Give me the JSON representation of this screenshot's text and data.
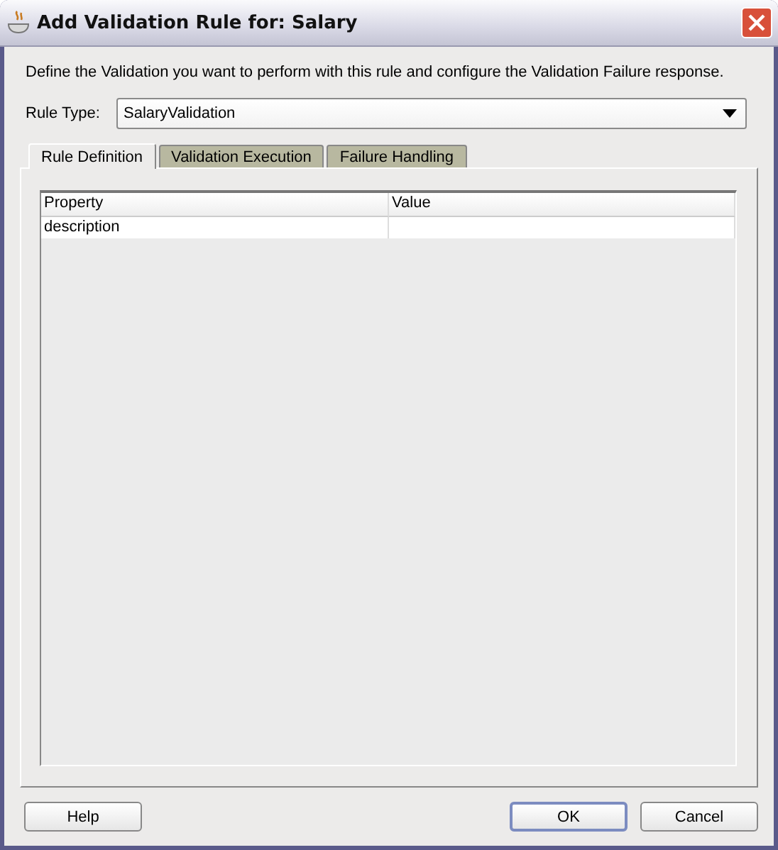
{
  "window": {
    "title": "Add Validation Rule for: Salary"
  },
  "intro": "Define the Validation you want to perform with this rule and configure the Validation Failure response.",
  "rule_type": {
    "label": "Rule Type:",
    "value": "SalaryValidation"
  },
  "tabs": [
    {
      "label": "Rule Definition",
      "selected": true
    },
    {
      "label": "Validation Execution",
      "selected": false
    },
    {
      "label": "Failure Handling",
      "selected": false
    }
  ],
  "table": {
    "columns": [
      "Property",
      "Value"
    ],
    "rows": [
      [
        "description",
        ""
      ]
    ]
  },
  "buttons": [
    {
      "label": "Help",
      "default": false
    },
    {
      "label": "OK",
      "default": true
    },
    {
      "label": "Cancel",
      "default": false
    }
  ]
}
